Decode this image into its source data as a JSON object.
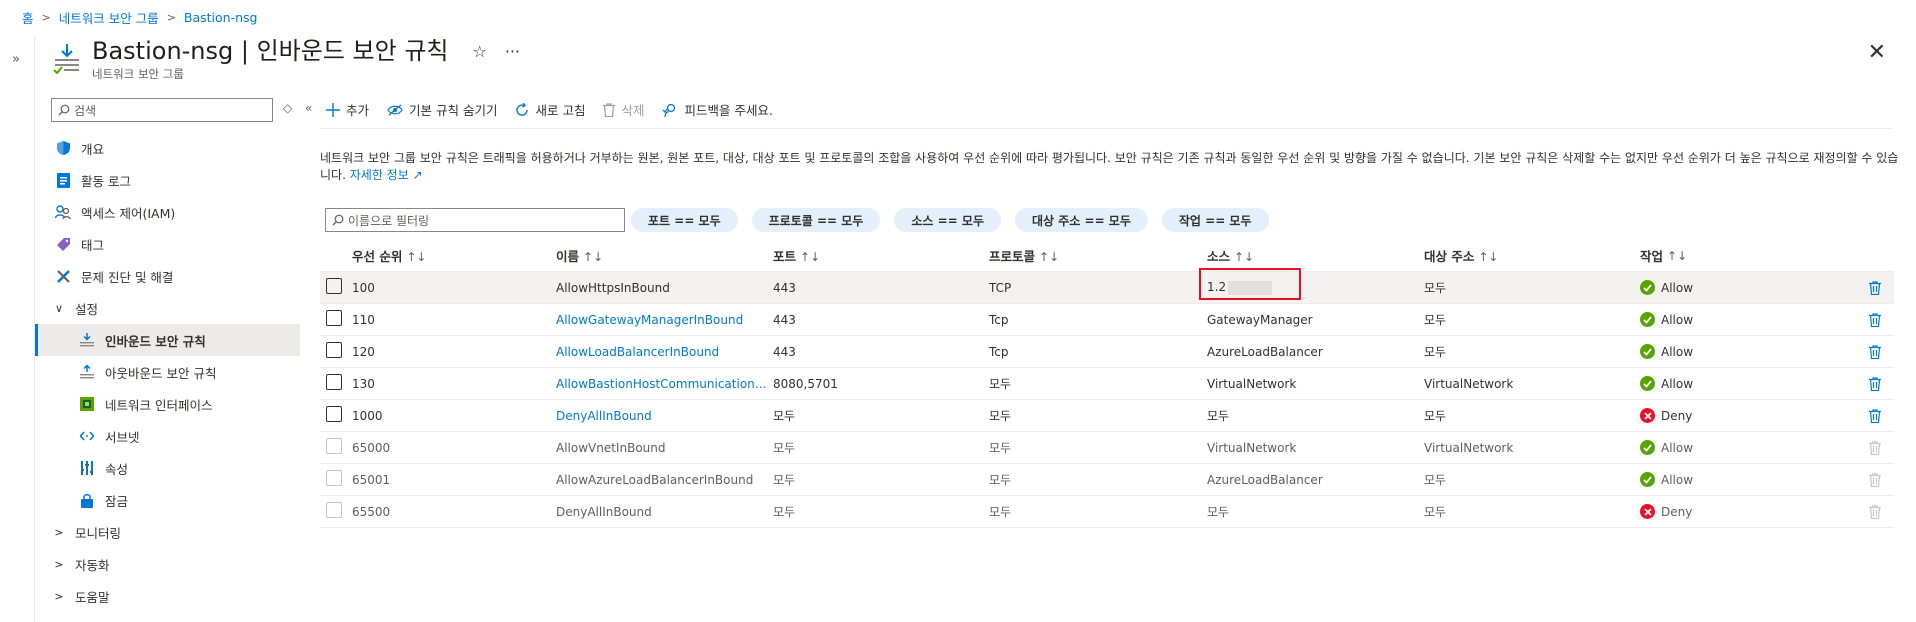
{
  "breadcrumb": [
    "홈",
    "네트워크 보안 그룹",
    "Bastion-nsg"
  ],
  "header": {
    "title": "Bastion-nsg | 인바운드 보안 규칙",
    "subtitle": "네트워크 보안 그룹",
    "favorite_icon": "star-icon",
    "more_icon": "ellipsis-icon"
  },
  "sidebar": {
    "search_placeholder": "검색",
    "items": [
      {
        "label": "개요",
        "icon": "shield-icon",
        "level": 0
      },
      {
        "label": "활동 로그",
        "icon": "log-icon",
        "level": 0
      },
      {
        "label": "액세스 제어(IAM)",
        "icon": "people-icon",
        "level": 0
      },
      {
        "label": "태그",
        "icon": "tag-icon",
        "level": 0
      },
      {
        "label": "문제 진단 및 해결",
        "icon": "wrench-icon",
        "level": 0
      },
      {
        "label": "설정",
        "icon": "chevron-down-icon",
        "level": 0,
        "expanded": true
      },
      {
        "label": "인바운드 보안 규칙",
        "icon": "inbound-icon",
        "level": 1,
        "active": true
      },
      {
        "label": "아웃바운드 보안 규칙",
        "icon": "outbound-icon",
        "level": 1
      },
      {
        "label": "네트워크 인터페이스",
        "icon": "nic-icon",
        "level": 1
      },
      {
        "label": "서브넷",
        "icon": "subnet-icon",
        "level": 1
      },
      {
        "label": "속성",
        "icon": "properties-icon",
        "level": 1
      },
      {
        "label": "잠금",
        "icon": "lock-icon",
        "level": 1
      },
      {
        "label": "모니터링",
        "icon": "chevron-right-icon",
        "level": 0
      },
      {
        "label": "자동화",
        "icon": "chevron-right-icon",
        "level": 0
      },
      {
        "label": "도움말",
        "icon": "chevron-right-icon",
        "level": 0
      }
    ]
  },
  "toolbar": {
    "add": "추가",
    "hide_default": "기본 규칙 숨기기",
    "refresh": "새로 고침",
    "delete": "삭제",
    "feedback": "피드백을 주세요."
  },
  "description": {
    "text": "네트워크 보안 그룹 보안 규칙은 트래픽을 허용하거나 거부하는 원본, 원본 포트, 대상, 대상 포트 및 프로토콜의 조합을 사용하여 우선 순위에 따라 평가됩니다. 보안 규칙은 기존 규칙과 동일한 우선 순위 및 방향을 가질 수 없습니다. 기본 보안 규칙은 삭제할 수는 없지만 우선 순위가 더 높은 규칙으로 재정의할 수 있습니다.",
    "link": "자세한 정보"
  },
  "filters": {
    "name_placeholder": "이름으로 필터링",
    "pills": [
      "포트 == 모두",
      "프로토콜 == 모두",
      "소스 == 모두",
      "대상 주소 == 모두",
      "작업 == 모두"
    ]
  },
  "table": {
    "columns": [
      "우선 순위",
      "이름",
      "포트",
      "프로토콜",
      "소스",
      "대상 주소",
      "작업"
    ],
    "rows": [
      {
        "priority": "100",
        "name": "AllowHttpsInBound",
        "port": "443",
        "protocol": "TCP",
        "source": "1.2",
        "dest": "모두",
        "action": "Allow",
        "link": false,
        "default": false
      },
      {
        "priority": "110",
        "name": "AllowGatewayManagerInBound",
        "port": "443",
        "protocol": "Tcp",
        "source": "GatewayManager",
        "dest": "모두",
        "action": "Allow",
        "link": true,
        "default": false
      },
      {
        "priority": "120",
        "name": "AllowLoadBalancerInBound",
        "port": "443",
        "protocol": "Tcp",
        "source": "AzureLoadBalancer",
        "dest": "모두",
        "action": "Allow",
        "link": true,
        "default": false
      },
      {
        "priority": "130",
        "name": "AllowBastionHostCommunication…",
        "port": "8080,5701",
        "protocol": "모두",
        "source": "VirtualNetwork",
        "dest": "VirtualNetwork",
        "action": "Allow",
        "link": true,
        "default": false
      },
      {
        "priority": "1000",
        "name": "DenyAllInBound",
        "port": "모두",
        "protocol": "모두",
        "source": "모두",
        "dest": "모두",
        "action": "Deny",
        "link": true,
        "default": false
      },
      {
        "priority": "65000",
        "name": "AllowVnetInBound",
        "port": "모두",
        "protocol": "모두",
        "source": "VirtualNetwork",
        "dest": "VirtualNetwork",
        "action": "Allow",
        "link": false,
        "default": true
      },
      {
        "priority": "65001",
        "name": "AllowAzureLoadBalancerInBound",
        "port": "모두",
        "protocol": "모두",
        "source": "AzureLoadBalancer",
        "dest": "모두",
        "action": "Allow",
        "link": false,
        "default": true
      },
      {
        "priority": "65500",
        "name": "DenyAllInBound",
        "port": "모두",
        "protocol": "모두",
        "source": "모두",
        "dest": "모두",
        "action": "Deny",
        "link": false,
        "default": true
      }
    ]
  },
  "colors": {
    "accent": "#0078d4",
    "allow": "#57a300",
    "deny": "#e81123"
  }
}
